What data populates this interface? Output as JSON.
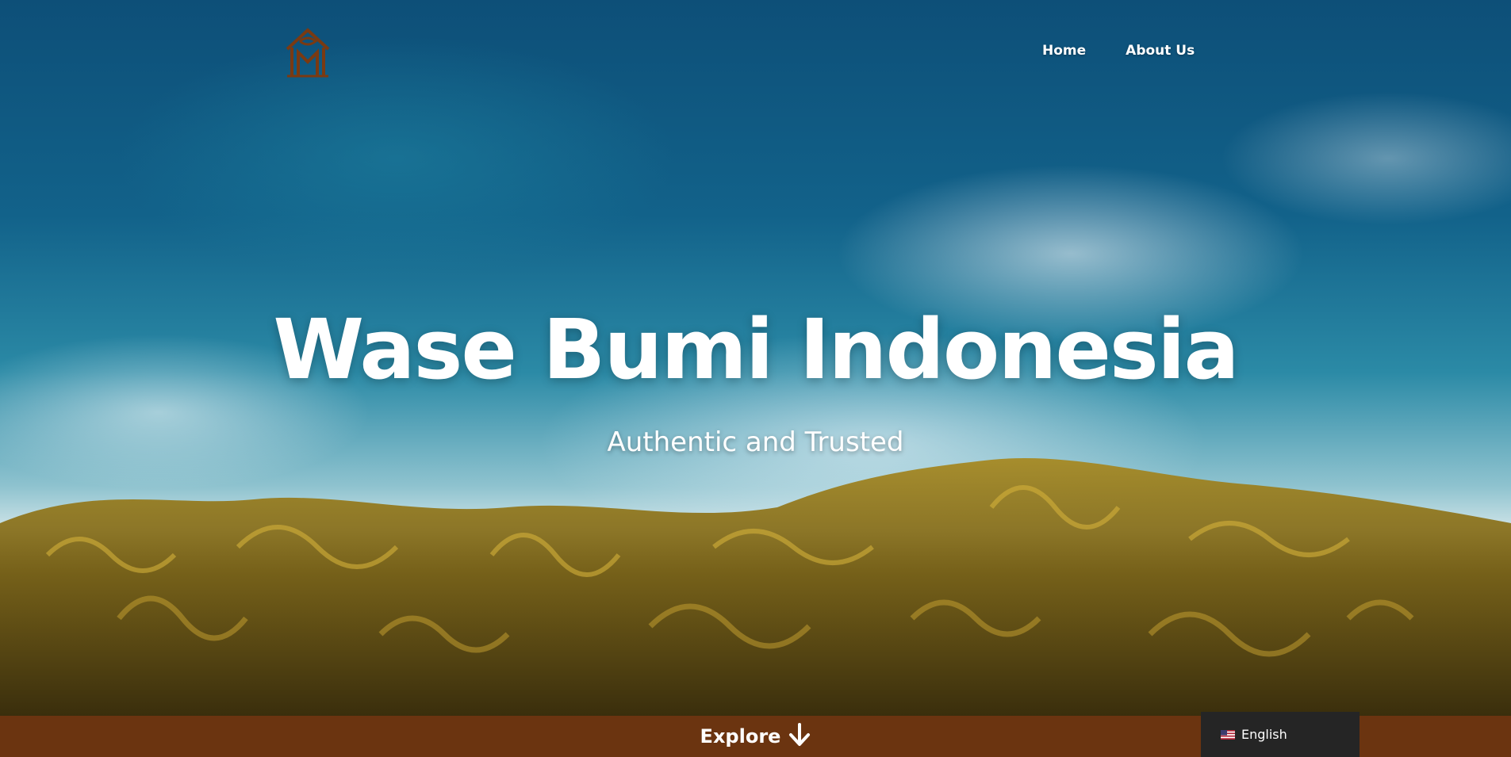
{
  "nav": {
    "logo_icon": "house-monogram-logo-icon",
    "links": [
      {
        "label": "Home"
      },
      {
        "label": "About Us"
      }
    ]
  },
  "hero": {
    "title": "Wase Bumi Indonesia",
    "subtitle": "Authentic and Trusted"
  },
  "footer_bar": {
    "explore_label": "Explore",
    "explore_icon": "arrow-down-icon",
    "background_color": "#6b3410"
  },
  "language": {
    "label": "English",
    "flag_icon": "us-flag-icon"
  },
  "colors": {
    "accent_brown": "#6b3410",
    "logo_brown": "#7a3a12",
    "language_bg": "#252525"
  }
}
